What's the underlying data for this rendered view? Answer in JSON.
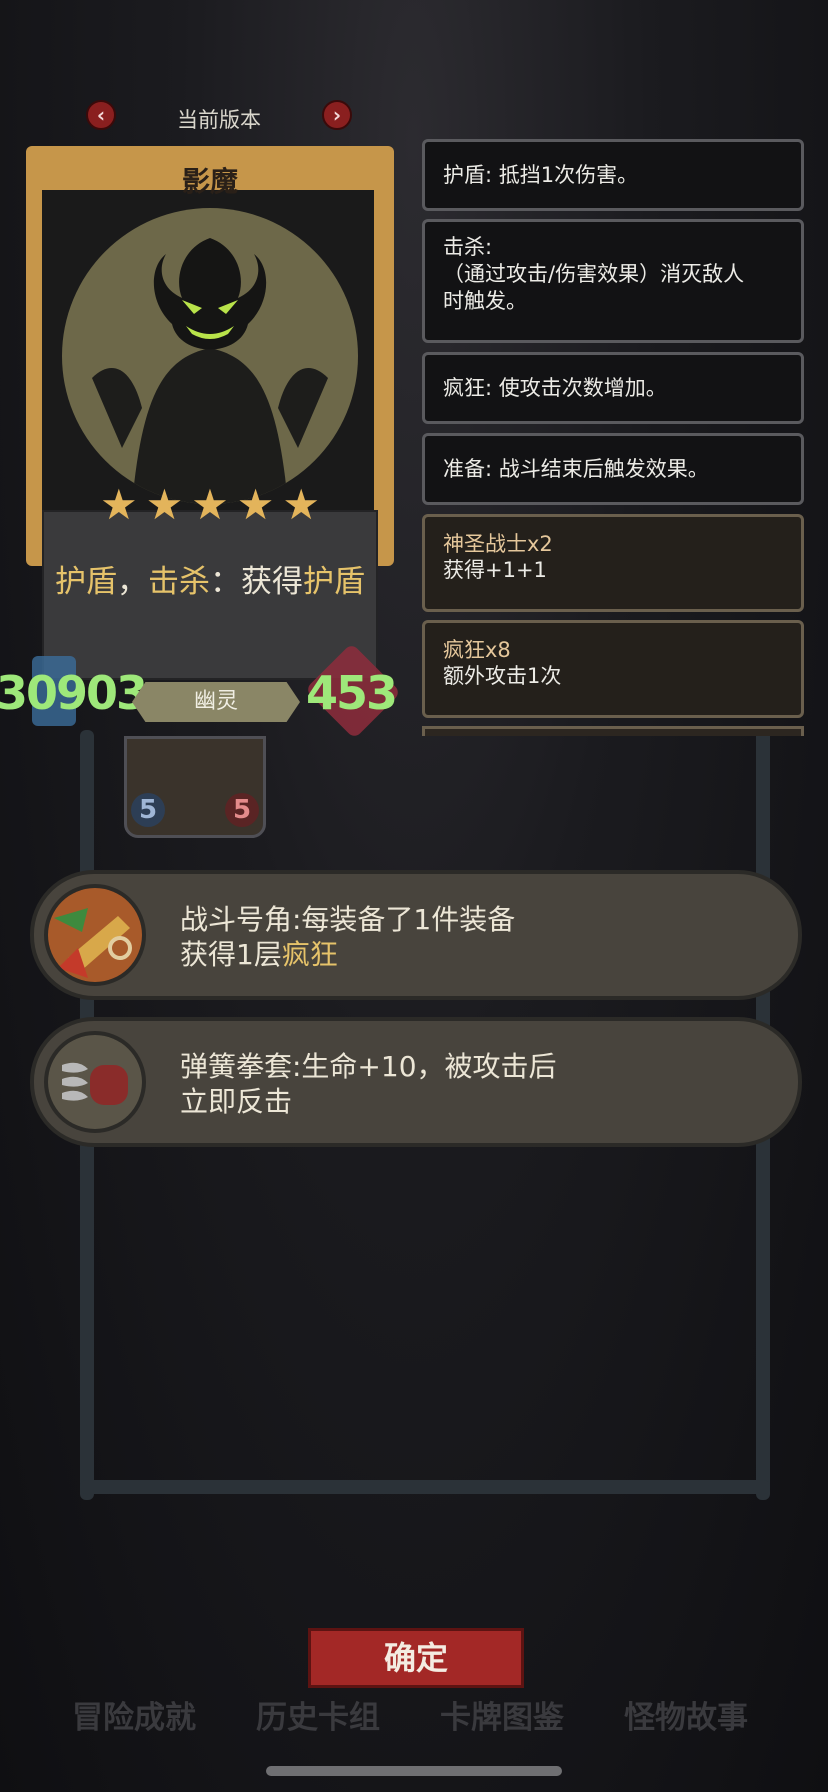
{
  "version": {
    "label": "当前版本",
    "prev_icon": "chevron-left-icon",
    "next_icon": "chevron-right-icon"
  },
  "card": {
    "name": "影魔",
    "stars": 5,
    "desc": {
      "k1": "护盾",
      "sep1": "，",
      "k2": "击杀",
      "mid": "：获得",
      "k3": "护盾"
    },
    "attack": "30903",
    "hp": "453",
    "type": "幽灵",
    "mini_card": {
      "left": "5",
      "right": "5"
    }
  },
  "keywords": [
    {
      "text": "护盾: 抵挡1次伤害。"
    },
    {
      "line1": "击杀:",
      "line2": "（通过攻击/伤害效果）消灭敌人",
      "line3": "时触发。"
    },
    {
      "text": "疯狂: 使攻击次数增加。"
    },
    {
      "text": "准备: 战斗结束后触发效果。"
    }
  ],
  "synergies": [
    {
      "title": "神圣战士x2",
      "effect": "获得+1+1"
    },
    {
      "title": "疯狂x8",
      "effect": "额外攻击1次"
    }
  ],
  "equipment": [
    {
      "line1": "战斗号角:每装备了1件装备",
      "line2_pre": "获得1层",
      "line2_kw": "疯狂",
      "icon": "war-horn-icon"
    },
    {
      "line1": "弹簧拳套:生命+10，被攻击后",
      "line2": "立即反击",
      "icon": "spring-glove-icon"
    }
  ],
  "confirm_label": "确定",
  "tabs": [
    "冒险成就",
    "历史卡组",
    "卡牌图鉴",
    "怪物故事"
  ],
  "colors": {
    "keyword_gold": "#e6c36a",
    "stat_green": "#9ee87a",
    "confirm_red": "#a32826"
  }
}
